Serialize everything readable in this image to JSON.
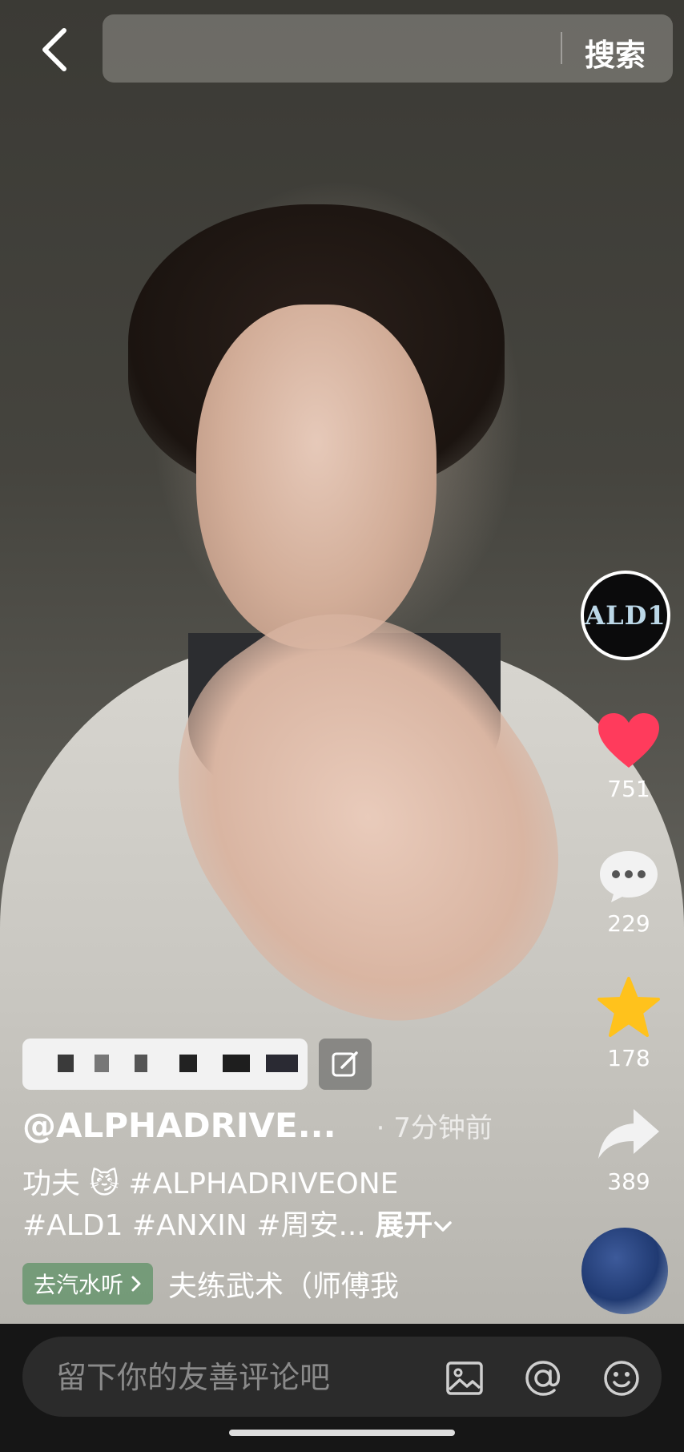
{
  "search": {
    "placeholder": "",
    "button_label": "搜索"
  },
  "rail": {
    "avatar_text": "ALD1",
    "like_count": "751",
    "comment_count": "229",
    "favorite_count": "178",
    "share_count": "389"
  },
  "post": {
    "author": "@ALPHADRIVE...",
    "time": "· 7分钟前",
    "description_line1": "功夫 😼 #ALPHADRIVEONE",
    "description_line2": "#ALD1 #ANXIN #周安...",
    "expand_label": "展开",
    "music_tag": "去汽水听",
    "music_title": "夫练武术（师傅我"
  },
  "comment_bar": {
    "placeholder": "留下你的友善评论吧"
  },
  "colors": {
    "like": "#ff3b5c",
    "favorite": "#ffc21c"
  },
  "icons": [
    "back-arrow-icon",
    "heart-icon",
    "comment-icon",
    "star-icon",
    "share-icon",
    "edit-icon",
    "image-icon",
    "at-icon",
    "emoji-icon",
    "chevron-right-icon",
    "chevron-down-icon"
  ]
}
